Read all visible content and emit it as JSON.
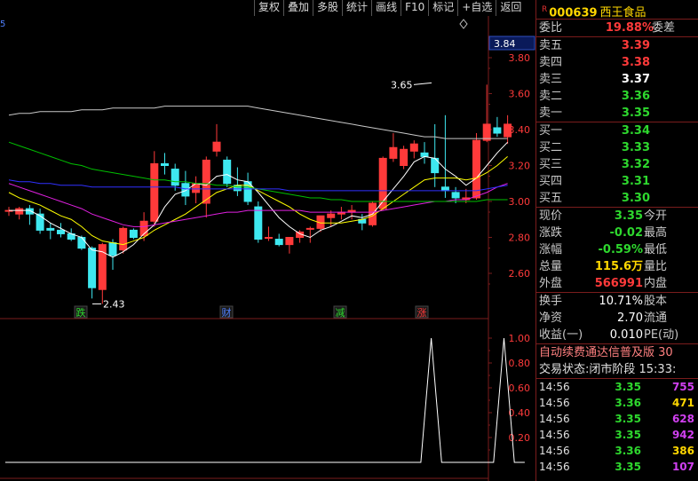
{
  "toolbar": {
    "buttons": [
      "复权",
      "叠加",
      "多股",
      "统计",
      "画线",
      "F10",
      "标记",
      "+自选",
      "返回"
    ]
  },
  "stock": {
    "badge": "R",
    "code": "000639",
    "name": "西王食品"
  },
  "main_chart": {
    "y_ticks": [
      "3.80",
      "3.60",
      "3.40",
      "3.20",
      "3.00",
      "2.80",
      "2.60"
    ],
    "current_price_label": "3.84",
    "high_annotation": "3.65",
    "low_annotation": "2.43",
    "markers": [
      {
        "text": "跌",
        "color": "#2ed82e"
      },
      {
        "text": "财",
        "color": "#5080ff"
      },
      {
        "text": "减",
        "color": "#2ed82e"
      },
      {
        "text": "涨",
        "color": "#ff3a3a"
      }
    ],
    "corner_label": "5"
  },
  "chart_data": {
    "type": "candlestick",
    "ylim": [
      2.4,
      3.9
    ],
    "candles": [
      {
        "o": 2.95,
        "h": 2.97,
        "l": 2.92,
        "c": 2.95
      },
      {
        "o": 2.93,
        "h": 2.97,
        "l": 2.9,
        "c": 2.96
      },
      {
        "o": 2.96,
        "h": 2.98,
        "l": 2.87,
        "c": 2.93
      },
      {
        "o": 2.93,
        "h": 2.96,
        "l": 2.82,
        "c": 2.84
      },
      {
        "o": 2.85,
        "h": 2.88,
        "l": 2.79,
        "c": 2.84
      },
      {
        "o": 2.84,
        "h": 2.88,
        "l": 2.8,
        "c": 2.82
      },
      {
        "o": 2.82,
        "h": 2.85,
        "l": 2.78,
        "c": 2.79
      },
      {
        "o": 2.8,
        "h": 2.81,
        "l": 2.73,
        "c": 2.74
      },
      {
        "o": 2.74,
        "h": 2.75,
        "l": 2.46,
        "c": 2.52
      },
      {
        "o": 2.51,
        "h": 2.77,
        "l": 2.43,
        "c": 2.76
      },
      {
        "o": 2.77,
        "h": 2.79,
        "l": 2.62,
        "c": 2.7
      },
      {
        "o": 2.73,
        "h": 2.86,
        "l": 2.71,
        "c": 2.85
      },
      {
        "o": 2.84,
        "h": 2.85,
        "l": 2.79,
        "c": 2.8
      },
      {
        "o": 2.81,
        "h": 2.94,
        "l": 2.78,
        "c": 2.89
      },
      {
        "o": 2.89,
        "h": 3.28,
        "l": 2.86,
        "c": 3.21
      },
      {
        "o": 3.21,
        "h": 3.27,
        "l": 3.15,
        "c": 3.2
      },
      {
        "o": 3.18,
        "h": 3.21,
        "l": 3.06,
        "c": 3.09
      },
      {
        "o": 3.1,
        "h": 3.17,
        "l": 2.98,
        "c": 3.03
      },
      {
        "o": 3.05,
        "h": 3.14,
        "l": 2.99,
        "c": 3.1
      },
      {
        "o": 2.99,
        "h": 3.25,
        "l": 2.91,
        "c": 3.23
      },
      {
        "o": 3.28,
        "h": 3.43,
        "l": 3.25,
        "c": 3.33
      },
      {
        "o": 3.23,
        "h": 3.25,
        "l": 3.08,
        "c": 3.1
      },
      {
        "o": 3.09,
        "h": 3.19,
        "l": 3.03,
        "c": 3.06
      },
      {
        "o": 3.11,
        "h": 3.16,
        "l": 2.98,
        "c": 3.0
      },
      {
        "o": 2.97,
        "h": 3.0,
        "l": 2.77,
        "c": 2.79
      },
      {
        "o": 2.8,
        "h": 2.86,
        "l": 2.78,
        "c": 2.8
      },
      {
        "o": 2.79,
        "h": 2.82,
        "l": 2.75,
        "c": 2.76
      },
      {
        "o": 2.76,
        "h": 2.8,
        "l": 2.71,
        "c": 2.8
      },
      {
        "o": 2.8,
        "h": 2.84,
        "l": 2.77,
        "c": 2.83
      },
      {
        "o": 2.85,
        "h": 2.86,
        "l": 2.77,
        "c": 2.85
      },
      {
        "o": 2.85,
        "h": 2.91,
        "l": 2.83,
        "c": 2.92
      },
      {
        "o": 2.91,
        "h": 2.95,
        "l": 2.86,
        "c": 2.93
      },
      {
        "o": 2.93,
        "h": 2.97,
        "l": 2.9,
        "c": 2.94
      },
      {
        "o": 2.94,
        "h": 2.98,
        "l": 2.9,
        "c": 2.95
      },
      {
        "o": 2.9,
        "h": 2.93,
        "l": 2.84,
        "c": 2.88
      },
      {
        "o": 2.87,
        "h": 3.0,
        "l": 2.86,
        "c": 2.99
      },
      {
        "o": 2.96,
        "h": 3.25,
        "l": 2.95,
        "c": 3.24
      },
      {
        "o": 3.24,
        "h": 3.38,
        "l": 3.22,
        "c": 3.3
      },
      {
        "o": 3.2,
        "h": 3.31,
        "l": 3.18,
        "c": 3.29
      },
      {
        "o": 3.28,
        "h": 3.34,
        "l": 3.24,
        "c": 3.32
      },
      {
        "o": 3.27,
        "h": 3.33,
        "l": 3.21,
        "c": 3.25
      },
      {
        "o": 3.24,
        "h": 3.43,
        "l": 3.08,
        "c": 3.16
      },
      {
        "o": 3.08,
        "h": 3.48,
        "l": 3.02,
        "c": 3.06
      },
      {
        "o": 3.05,
        "h": 3.08,
        "l": 2.99,
        "c": 3.02
      },
      {
        "o": 3.01,
        "h": 3.07,
        "l": 2.99,
        "c": 3.02
      },
      {
        "o": 3.02,
        "h": 3.38,
        "l": 3.01,
        "c": 3.34
      },
      {
        "o": 3.34,
        "h": 3.65,
        "l": 3.33,
        "c": 3.43
      },
      {
        "o": 3.41,
        "h": 3.47,
        "l": 3.36,
        "c": 3.38
      },
      {
        "o": 3.36,
        "h": 3.48,
        "l": 3.32,
        "c": 3.43
      }
    ],
    "ma_lines": [
      {
        "color": "#ffffff",
        "values": [
          2.95,
          2.95,
          2.95,
          2.92,
          2.88,
          2.85,
          2.82,
          2.8,
          2.73,
          2.72,
          2.69,
          2.72,
          2.76,
          2.82,
          2.87,
          2.97,
          3.04,
          3.06,
          3.1,
          3.09,
          3.14,
          3.15,
          3.12,
          3.11,
          3.05,
          2.98,
          2.91,
          2.86,
          2.82,
          2.8,
          2.84,
          2.86,
          2.89,
          2.92,
          2.91,
          2.93,
          3.0,
          3.07,
          3.14,
          3.22,
          3.25,
          3.24,
          3.18,
          3.14,
          3.09,
          3.13,
          3.2,
          3.27,
          3.33
        ]
      },
      {
        "color": "#ffff00",
        "values": [
          3.05,
          3.02,
          3.0,
          2.98,
          2.95,
          2.92,
          2.9,
          2.86,
          2.81,
          2.78,
          2.77,
          2.76,
          2.78,
          2.8,
          2.84,
          2.87,
          2.9,
          2.93,
          2.97,
          3.01,
          3.05,
          3.07,
          3.09,
          3.09,
          3.06,
          3.03,
          3.0,
          2.97,
          2.93,
          2.9,
          2.88,
          2.88,
          2.88,
          2.89,
          2.9,
          2.92,
          2.96,
          3.0,
          3.04,
          3.08,
          3.12,
          3.13,
          3.13,
          3.13,
          3.12,
          3.13,
          3.16,
          3.2,
          3.25
        ]
      },
      {
        "color": "#e020e0",
        "values": [
          3.1,
          3.08,
          3.06,
          3.04,
          3.02,
          3.0,
          2.98,
          2.96,
          2.93,
          2.91,
          2.89,
          2.87,
          2.86,
          2.86,
          2.87,
          2.88,
          2.89,
          2.9,
          2.91,
          2.92,
          2.93,
          2.94,
          2.94,
          2.95,
          2.95,
          2.95,
          2.95,
          2.95,
          2.95,
          2.94,
          2.94,
          2.94,
          2.94,
          2.94,
          2.94,
          2.94,
          2.95,
          2.96,
          2.97,
          2.98,
          2.99,
          3.0,
          3.0,
          3.01,
          3.01,
          3.03,
          3.05,
          3.08,
          3.1
        ]
      },
      {
        "color": "#00c000",
        "values": [
          3.33,
          3.31,
          3.29,
          3.27,
          3.25,
          3.23,
          3.21,
          3.2,
          3.18,
          3.17,
          3.16,
          3.15,
          3.14,
          3.13,
          3.12,
          3.12,
          3.11,
          3.11,
          3.1,
          3.1,
          3.09,
          3.09,
          3.08,
          3.08,
          3.07,
          3.06,
          3.05,
          3.04,
          3.03,
          3.02,
          3.02,
          3.01,
          3.01,
          3.0,
          3.0,
          3.0,
          3.0,
          3.0,
          3.0,
          3.0,
          3.0,
          3.0,
          3.0,
          3.0,
          3.0,
          3.0,
          3.01,
          3.01,
          3.01
        ]
      },
      {
        "color": "#3030ff",
        "values": [
          3.12,
          3.11,
          3.11,
          3.1,
          3.1,
          3.09,
          3.09,
          3.09,
          3.08,
          3.08,
          3.08,
          3.08,
          3.08,
          3.08,
          3.08,
          3.08,
          3.08,
          3.07,
          3.07,
          3.07,
          3.07,
          3.07,
          3.07,
          3.07,
          3.07,
          3.07,
          3.07,
          3.06,
          3.06,
          3.06,
          3.06,
          3.06,
          3.06,
          3.06,
          3.06,
          3.06,
          3.06,
          3.06,
          3.06,
          3.06,
          3.06,
          3.06,
          3.06,
          3.06,
          3.06,
          3.06,
          3.07,
          3.08,
          3.09
        ]
      },
      {
        "color": "#c8c8c8",
        "values": [
          3.48,
          3.49,
          3.49,
          3.5,
          3.5,
          3.5,
          3.5,
          3.51,
          3.51,
          3.51,
          3.52,
          3.52,
          3.52,
          3.52,
          3.52,
          3.53,
          3.53,
          3.53,
          3.53,
          3.53,
          3.53,
          3.53,
          3.53,
          3.53,
          3.52,
          3.51,
          3.5,
          3.49,
          3.48,
          3.47,
          3.46,
          3.45,
          3.44,
          3.43,
          3.42,
          3.41,
          3.4,
          3.39,
          3.38,
          3.37,
          3.36,
          3.36,
          3.35,
          3.35,
          3.35,
          3.35,
          3.35,
          3.35,
          3.35
        ]
      }
    ],
    "sub_y_ticks": [
      "1.00",
      "0.80",
      "0.60",
      "0.40",
      "0.20"
    ],
    "sub_ylim": [
      0,
      1.1
    ],
    "signal_values": [
      0,
      0,
      0,
      0,
      0,
      0,
      0,
      0,
      0,
      0,
      0,
      0,
      0,
      0,
      0,
      0,
      0,
      0,
      0,
      0,
      0,
      0,
      0,
      0,
      0,
      0,
      0,
      0,
      0,
      0,
      0,
      0,
      0,
      0,
      0,
      0,
      0,
      0,
      0,
      0,
      0,
      1,
      0,
      0,
      0,
      0,
      0,
      0,
      1,
      0,
      0
    ]
  },
  "order_book": {
    "ratio_label": "委比",
    "ratio_value": "19.88%",
    "diff_label": "委差",
    "asks": [
      {
        "label": "卖五",
        "price": "3.39",
        "color": "red"
      },
      {
        "label": "卖四",
        "price": "3.38",
        "color": "red"
      },
      {
        "label": "卖三",
        "price": "3.37",
        "color": "white"
      },
      {
        "label": "卖二",
        "price": "3.36",
        "color": "green"
      },
      {
        "label": "卖一",
        "price": "3.35",
        "color": "green"
      }
    ],
    "bids": [
      {
        "label": "买一",
        "price": "3.34",
        "color": "green"
      },
      {
        "label": "买二",
        "price": "3.33",
        "color": "green"
      },
      {
        "label": "买三",
        "price": "3.32",
        "color": "green"
      },
      {
        "label": "买四",
        "price": "3.31",
        "color": "green"
      },
      {
        "label": "买五",
        "price": "3.30",
        "color": "green"
      }
    ]
  },
  "quote": [
    {
      "label": "现价",
      "value": "3.35",
      "color": "green",
      "label2": "今开"
    },
    {
      "label": "涨跌",
      "value": "-0.02",
      "color": "green",
      "label2": "最高"
    },
    {
      "label": "涨幅",
      "value": "-0.59%",
      "color": "green",
      "label2": "最低"
    },
    {
      "label": "总量",
      "value": "115.6万",
      "color": "yellow",
      "label2": "量比"
    },
    {
      "label": "外盘",
      "value": "566991",
      "color": "red",
      "label2": "内盘"
    }
  ],
  "fundamentals": [
    {
      "label": "换手",
      "value": "10.71%",
      "label2": "股本"
    },
    {
      "label": "净资",
      "value": "2.70",
      "label2": "流通"
    },
    {
      "label": "收益(一)",
      "value": "0.010",
      "label2": "PE(动)"
    }
  ],
  "info_banner": "自动续费通达信普及版 30",
  "status_line": "交易状态:闭市阶段 15:33:",
  "ticks": [
    {
      "time": "14:56",
      "price": "3.35",
      "vol": "755",
      "vol_color": "purple"
    },
    {
      "time": "14:56",
      "price": "3.36",
      "vol": "471",
      "vol_color": "yellow"
    },
    {
      "time": "14:56",
      "price": "3.35",
      "vol": "628",
      "vol_color": "purple"
    },
    {
      "time": "14:56",
      "price": "3.35",
      "vol": "942",
      "vol_color": "purple"
    },
    {
      "time": "14:56",
      "price": "3.36",
      "vol": "386",
      "vol_color": "yellow"
    },
    {
      "time": "14:56",
      "price": "3.35",
      "vol": "107",
      "vol_color": "purple"
    }
  ]
}
